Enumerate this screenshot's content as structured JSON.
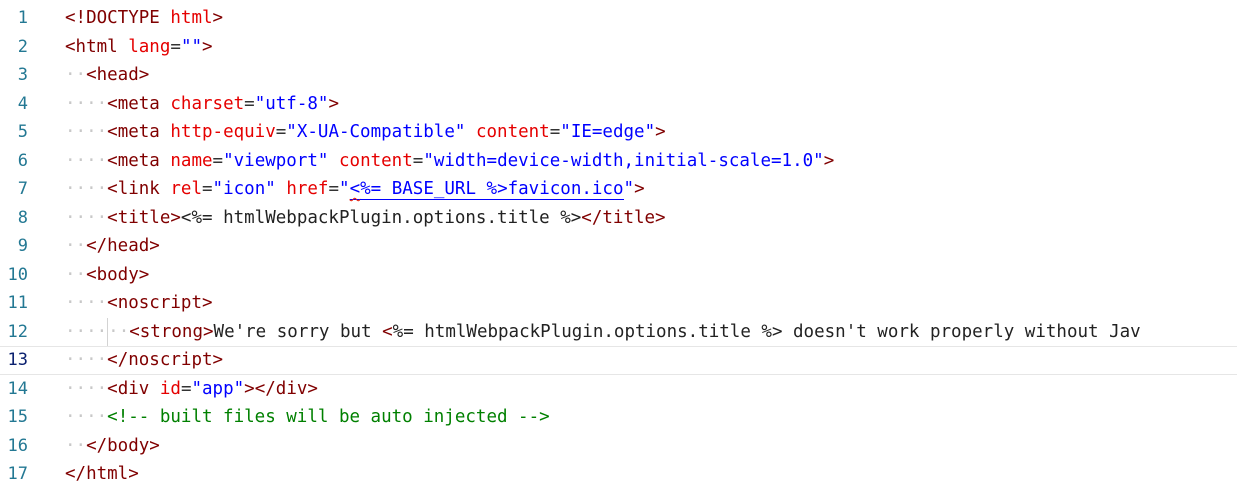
{
  "editor": {
    "language": "html",
    "current_line": 13,
    "lines": [
      {
        "num": "1",
        "tokens": [
          {
            "t": "<!DOCTYPE",
            "c": "tag"
          },
          {
            "t": " ",
            "c": "text"
          },
          {
            "t": "html",
            "c": "attr"
          },
          {
            "t": ">",
            "c": "delim"
          }
        ]
      },
      {
        "num": "2",
        "tokens": [
          {
            "t": "<html",
            "c": "tag"
          },
          {
            "t": " ",
            "c": "text"
          },
          {
            "t": "lang",
            "c": "attr"
          },
          {
            "t": "=",
            "c": "eq"
          },
          {
            "t": "\"\"",
            "c": "str"
          },
          {
            "t": ">",
            "c": "delim"
          }
        ]
      },
      {
        "num": "3",
        "indent": 1,
        "tokens": [
          {
            "t": "<head>",
            "c": "tag"
          }
        ]
      },
      {
        "num": "4",
        "indent": 2,
        "tokens": [
          {
            "t": "<meta",
            "c": "tag"
          },
          {
            "t": " ",
            "c": "text"
          },
          {
            "t": "charset",
            "c": "attr"
          },
          {
            "t": "=",
            "c": "eq"
          },
          {
            "t": "\"utf-8\"",
            "c": "str"
          },
          {
            "t": ">",
            "c": "delim"
          }
        ]
      },
      {
        "num": "5",
        "indent": 2,
        "tokens": [
          {
            "t": "<meta",
            "c": "tag"
          },
          {
            "t": " ",
            "c": "text"
          },
          {
            "t": "http-equiv",
            "c": "attr"
          },
          {
            "t": "=",
            "c": "eq"
          },
          {
            "t": "\"X-UA-Compatible\"",
            "c": "str"
          },
          {
            "t": " ",
            "c": "text"
          },
          {
            "t": "content",
            "c": "attr"
          },
          {
            "t": "=",
            "c": "eq"
          },
          {
            "t": "\"IE=edge\"",
            "c": "str"
          },
          {
            "t": ">",
            "c": "delim"
          }
        ]
      },
      {
        "num": "6",
        "indent": 2,
        "tokens": [
          {
            "t": "<meta",
            "c": "tag"
          },
          {
            "t": " ",
            "c": "text"
          },
          {
            "t": "name",
            "c": "attr"
          },
          {
            "t": "=",
            "c": "eq"
          },
          {
            "t": "\"viewport\"",
            "c": "str"
          },
          {
            "t": " ",
            "c": "text"
          },
          {
            "t": "content",
            "c": "attr"
          },
          {
            "t": "=",
            "c": "eq"
          },
          {
            "t": "\"width=device-width,initial-scale=1.0\"",
            "c": "str"
          },
          {
            "t": ">",
            "c": "delim"
          }
        ]
      },
      {
        "num": "7",
        "indent": 2,
        "tokens": [
          {
            "t": "<link",
            "c": "tag"
          },
          {
            "t": " ",
            "c": "text"
          },
          {
            "t": "rel",
            "c": "attr"
          },
          {
            "t": "=",
            "c": "eq"
          },
          {
            "t": "\"icon\"",
            "c": "str"
          },
          {
            "t": " ",
            "c": "text"
          },
          {
            "t": "href",
            "c": "attr"
          },
          {
            "t": "=",
            "c": "eq"
          },
          {
            "t": "\"",
            "c": "str"
          },
          {
            "t": "<",
            "c": "str",
            "squiggle": true,
            "link": true
          },
          {
            "t": "%= BASE_URL %>favicon.ico",
            "c": "str",
            "link": true
          },
          {
            "t": "\"",
            "c": "str"
          },
          {
            "t": ">",
            "c": "delim"
          }
        ]
      },
      {
        "num": "8",
        "indent": 2,
        "tokens": [
          {
            "t": "<title>",
            "c": "tag"
          },
          {
            "t": "<%= htmlWebpackPlugin.options.title %>",
            "c": "text"
          },
          {
            "t": "</title>",
            "c": "tag"
          }
        ]
      },
      {
        "num": "9",
        "indent": 1,
        "tokens": [
          {
            "t": "</head>",
            "c": "tag"
          }
        ]
      },
      {
        "num": "10",
        "indent": 1,
        "tokens": [
          {
            "t": "<body>",
            "c": "tag"
          }
        ]
      },
      {
        "num": "11",
        "indent": 2,
        "tokens": [
          {
            "t": "<noscript>",
            "c": "tag"
          }
        ]
      },
      {
        "num": "12",
        "indent": 3,
        "tokens": [
          {
            "t": "<strong>",
            "c": "tag"
          },
          {
            "t": "We're sorry but ",
            "c": "text"
          },
          {
            "t": "<",
            "c": "tag"
          },
          {
            "t": "%= htmlWebpackPlugin.options.title %> doesn't work properly without Jav",
            "c": "text"
          }
        ]
      },
      {
        "num": "13",
        "indent": 2,
        "tokens": [
          {
            "t": "</noscript>",
            "c": "tag"
          }
        ]
      },
      {
        "num": "14",
        "indent": 2,
        "tokens": [
          {
            "t": "<div",
            "c": "tag"
          },
          {
            "t": " ",
            "c": "text"
          },
          {
            "t": "id",
            "c": "attr"
          },
          {
            "t": "=",
            "c": "eq"
          },
          {
            "t": "\"app\"",
            "c": "str"
          },
          {
            "t": "></div>",
            "c": "tag"
          }
        ]
      },
      {
        "num": "15",
        "indent": 2,
        "tokens": [
          {
            "t": "<!-- built files will be auto injected -->",
            "c": "comment"
          }
        ]
      },
      {
        "num": "16",
        "indent": 1,
        "tokens": [
          {
            "t": "</body>",
            "c": "tag"
          }
        ]
      },
      {
        "num": "17",
        "tokens": [
          {
            "t": "</html>",
            "c": "tag"
          }
        ]
      }
    ]
  }
}
